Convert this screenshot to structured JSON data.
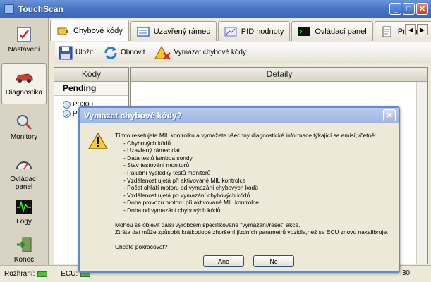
{
  "window": {
    "title": "TouchScan",
    "controls": {
      "minimize": "_",
      "maximize": "□",
      "close": "✕"
    }
  },
  "sidebar": {
    "items": [
      {
        "label": "Nastavení",
        "icon": "checklist-icon"
      },
      {
        "label": "Diagnostika",
        "icon": "car-icon"
      },
      {
        "label": "Monitory",
        "icon": "magnifier-icon"
      },
      {
        "label": "Ovládací panel",
        "icon": "gauge-icon"
      },
      {
        "label": "Logy",
        "icon": "waveform-icon"
      },
      {
        "label": "Konec",
        "icon": "exit-icon"
      }
    ],
    "active": "Diagnostika"
  },
  "tabs": [
    {
      "label": "Chybové kódy",
      "icon": "engine-icon",
      "active": true
    },
    {
      "label": "Uzavřený rámec",
      "icon": "frame-icon",
      "active": false
    },
    {
      "label": "PID hodnoty",
      "icon": "chart-icon",
      "active": false
    },
    {
      "label": "Ovládací panel",
      "icon": "terminal-icon",
      "active": false
    },
    {
      "label": "Prvotní",
      "icon": "document-icon",
      "active": false
    }
  ],
  "toolbar": {
    "save_label": "Uložit",
    "refresh_label": "Obnovit",
    "clear_label": "Vymazat chybové kódy"
  },
  "codes_panel": {
    "header": "Kódy",
    "section": "Pending",
    "items": [
      "P0300",
      "P"
    ]
  },
  "details_panel": {
    "header": "Detaily"
  },
  "statusbar": {
    "interface_label": "Rozhraní:",
    "ecu_label": "ECU:",
    "right_text": "30"
  },
  "dialog": {
    "title": "Vymazat chybové kódy?",
    "intro": "Tímto resetujete MIL kontrolku a vymažete všechny diagnostické informace týkající se emisí,včetně:",
    "list": [
      "- Chybových kódů",
      "- Uzavřený rámec dat",
      "- Data testů lambda sondy",
      "- Stav testování monitorů",
      "- Palubní výsledky testů monitorů",
      "- Vzdálenost ujetá při aktivované MIL kontrolce",
      "- Počet ohřátí motoru od vymazání chybových kódů",
      "- Vzdálenost ujetá po vymazání chybových kódů",
      "- Doba provozu motoru při aktivované MIL kontrolce",
      "- Doba od vymazání chybových kódů"
    ],
    "note1": "Mohou se objevit další výrobcem specifikované \"vymazání/reset\" akce.",
    "note2": "Ztráta dat může způsobit krátkodobé zhoršení jízdních parametrů vozidla,než se ECU znovu nakalibruje.",
    "question": "Chcete pokračovat?",
    "yes_label": "Ano",
    "no_label": "Ne"
  },
  "colors": {
    "titlebar": "#4a76c7",
    "dialog_border": "#6587cc",
    "status_led": "#4bbf3d"
  }
}
